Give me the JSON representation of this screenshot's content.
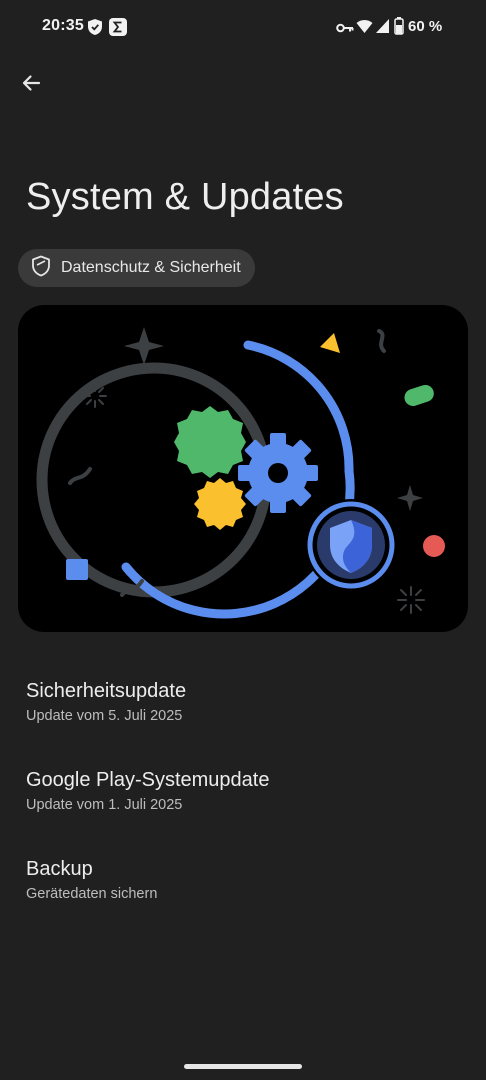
{
  "status_bar": {
    "time": "20:35",
    "battery": "60 %",
    "icons": [
      "shield-status-icon",
      "sigma-app-icon",
      "vpn-key-icon",
      "wifi-icon",
      "signal-icon",
      "battery-icon"
    ]
  },
  "header": {
    "back_icon": "arrow-back-icon",
    "title": "System & Updates"
  },
  "chip": {
    "icon": "shield-outline-icon",
    "label": "Datenschutz & Sicherheit"
  },
  "colors": {
    "background": "#202020",
    "blue": "#5b8def",
    "green": "#4fb86b",
    "yellow": "#fbc02d",
    "red": "#e65a55"
  },
  "items": [
    {
      "title": "Sicherheitsupdate",
      "subtitle": "Update vom 5. Juli 2025"
    },
    {
      "title": "Google Play-Systemupdate",
      "subtitle": "Update vom 1. Juli 2025"
    },
    {
      "title": "Backup",
      "subtitle": "Gerätedaten sichern"
    }
  ]
}
